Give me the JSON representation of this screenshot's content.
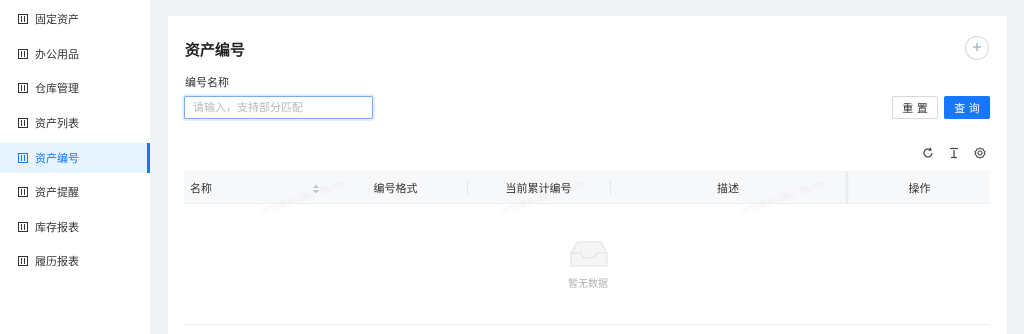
{
  "sidebar": {
    "items": [
      {
        "label": "固定资产",
        "active": false
      },
      {
        "label": "办公用品",
        "active": false
      },
      {
        "label": "仓库管理",
        "active": false
      },
      {
        "label": "资产列表",
        "active": false
      },
      {
        "label": "资产编号",
        "active": true
      },
      {
        "label": "资产提醒",
        "active": false
      },
      {
        "label": "库存报表",
        "active": false
      },
      {
        "label": "履历报表",
        "active": false
      }
    ],
    "item_icon": "grid-box-icon"
  },
  "main": {
    "title": "资产编号",
    "add_icon": "plus-circle-icon",
    "filter": {
      "label": "编号名称",
      "placeholder": "请输入，支持部分匹配"
    },
    "buttons": {
      "reset": "重 置",
      "query": "查 询"
    },
    "toolbar_icons": [
      "refresh-icon",
      "export-icon",
      "settings-icon"
    ],
    "table": {
      "columns": [
        "名称",
        "编号格式",
        "当前累计编号",
        "描述",
        "操作"
      ],
      "rows": [],
      "empty_text": "暂无数据"
    },
    "watermark": "小竹编示（新）张info"
  },
  "colors": {
    "accent": "#1677ff",
    "active_bg": "#e6f4ff",
    "page_bg": "#f0f2f5"
  }
}
